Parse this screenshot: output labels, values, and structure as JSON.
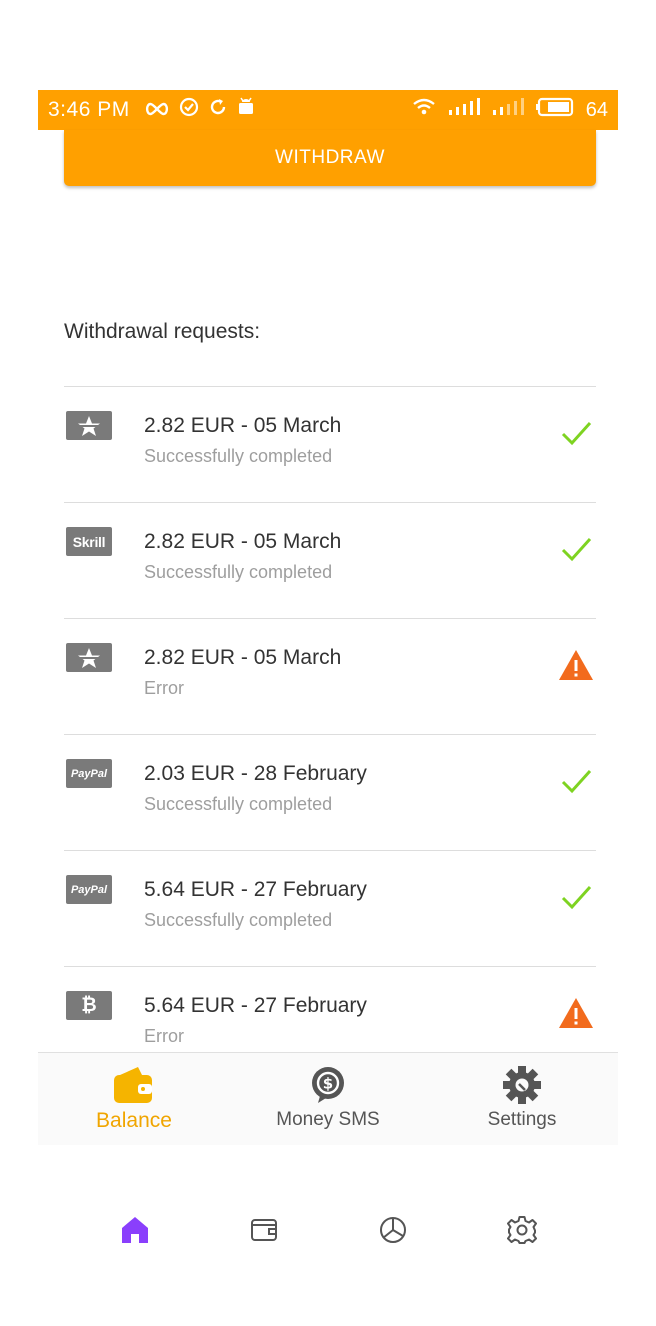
{
  "status_bar": {
    "time": "3:46 PM",
    "battery_percent": "64",
    "icons": [
      "infinity-icon",
      "check-circle-icon",
      "sync-icon",
      "android-icon",
      "wifi-icon",
      "signal-icon",
      "signal-weak-icon",
      "battery-icon"
    ]
  },
  "withdraw_button": {
    "label": "WITHDRAW"
  },
  "section_title": "Withdrawal requests:",
  "requests": [
    {
      "method_icon": "star-payout-icon",
      "amount_date": "2.82 EUR - 05 March",
      "status": "Successfully completed",
      "status_icon": "check-icon"
    },
    {
      "method_icon": "skrill-icon",
      "method_text": "Skrill",
      "amount_date": "2.82 EUR - 05 March",
      "status": "Successfully completed",
      "status_icon": "check-icon"
    },
    {
      "method_icon": "star-payout-icon",
      "amount_date": "2.82 EUR - 05 March",
      "status": "Error",
      "status_icon": "warning-icon"
    },
    {
      "method_icon": "paypal-icon",
      "method_text": "PayPal",
      "amount_date": "2.03 EUR - 28 February",
      "status": "Successfully completed",
      "status_icon": "check-icon"
    },
    {
      "method_icon": "paypal-icon",
      "method_text": "PayPal",
      "amount_date": "5.64 EUR - 27 February",
      "status": "Successfully completed",
      "status_icon": "check-icon"
    },
    {
      "method_icon": "bitcoin-icon",
      "method_text": "₿",
      "amount_date": "5.64 EUR - 27 February",
      "status": "Error",
      "status_icon": "warning-icon"
    }
  ],
  "bottom_nav": {
    "items": [
      {
        "label": "Balance",
        "icon": "wallet-icon",
        "active": true
      },
      {
        "label": "Money SMS",
        "icon": "money-sms-icon",
        "active": false
      },
      {
        "label": "Settings",
        "icon": "settings-gear-icon",
        "active": false
      }
    ]
  },
  "system_nav": {
    "items": [
      "home-icon",
      "wallet-outline-icon",
      "pie-chart-icon",
      "gear-outline-icon"
    ]
  },
  "colors": {
    "accent": "#ffa000",
    "success": "#7ed321",
    "error": "#f26b1d",
    "active_nav": "#f0a500",
    "home_active": "#8a3ffc"
  }
}
